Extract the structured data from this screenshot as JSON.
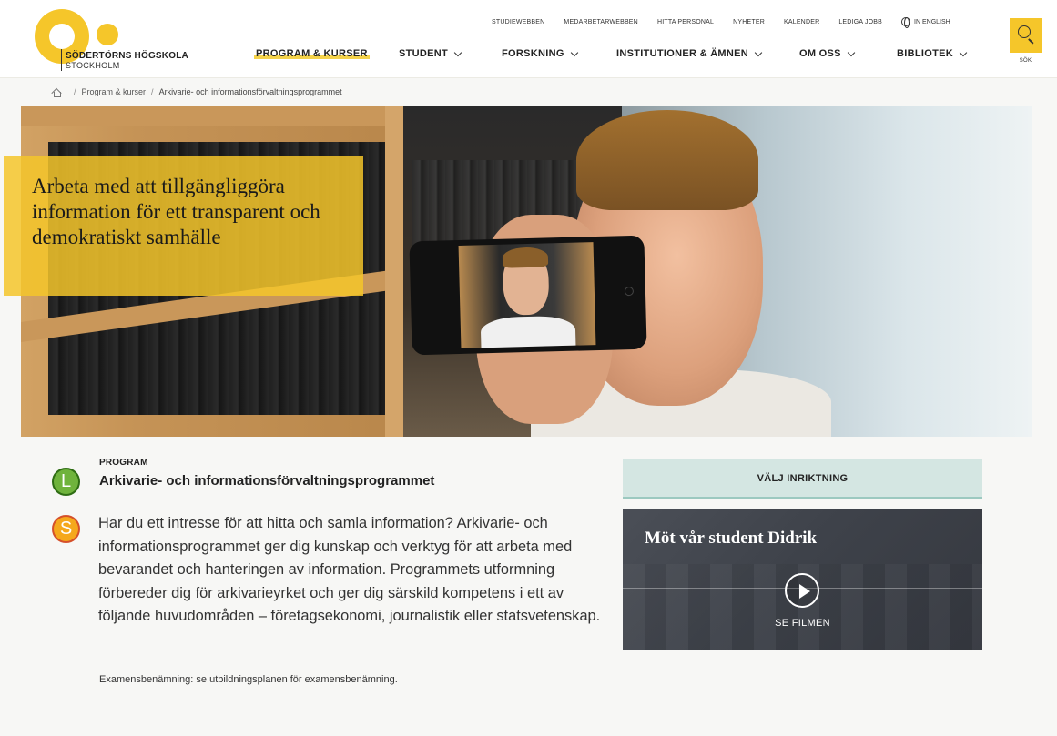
{
  "site": {
    "logo_name": "SÖDERTÖRNS HÖGSKOLA",
    "logo_city": "STOCKHOLM"
  },
  "utility_nav": [
    "STUDIEWEBBEN",
    "MEDARBETARWEBBEN",
    "HITTA PERSONAL",
    "NYHETER",
    "KALENDER",
    "LEDIGA JOBB"
  ],
  "language_link": "IN ENGLISH",
  "main_nav": [
    {
      "label": "PROGRAM & KURSER",
      "active": true
    },
    {
      "label": "STUDENT",
      "dropdown": true
    },
    {
      "label": "FORSKNING",
      "dropdown": true
    },
    {
      "label": "INSTITUTIONER & ÄMNEN",
      "dropdown": true
    },
    {
      "label": "OM OSS",
      "dropdown": true
    },
    {
      "label": "BIBLIOTEK",
      "dropdown": true
    }
  ],
  "search": {
    "label": "SÖK",
    "icon": "search-icon"
  },
  "breadcrumb": {
    "home_icon": "home-icon",
    "items": [
      "Program & kurser",
      "Arkivarie- och informationsförvaltningsprogrammet"
    ]
  },
  "hero": {
    "caption": "Arbeta med att tillgängliggöra information för ett transparent och demokratiskt samhälle"
  },
  "program": {
    "label": "PROGRAM",
    "title": "Arkivarie- och informationsförvaltningsprogrammet",
    "intro": "Har du ett intresse för att hitta och samla information? Arkivarie- och informationsprogrammet ger dig kunskap och verktyg för att arbeta med bevarandet och hanteringen av information. Programmets utformning förbereder dig för arkivarieyrket och ger dig särskild kompetens i ett av följande huvudområden – företagsekonomi, journalistik eller statsvetenskap.",
    "degree": "Examensbenämning: se utbildningsplanen för examensbenämning."
  },
  "badges": {
    "l": "L",
    "s": "S"
  },
  "sidebar": {
    "choose_button": "VÄLJ INRIKTNING",
    "video_title": "Möt vår student Didrik",
    "video_cta": "SE FILMEN"
  },
  "colors": {
    "accent": "#f5c62a",
    "choose_bg": "#d4e6e2",
    "video_bg": "#3e424a"
  }
}
